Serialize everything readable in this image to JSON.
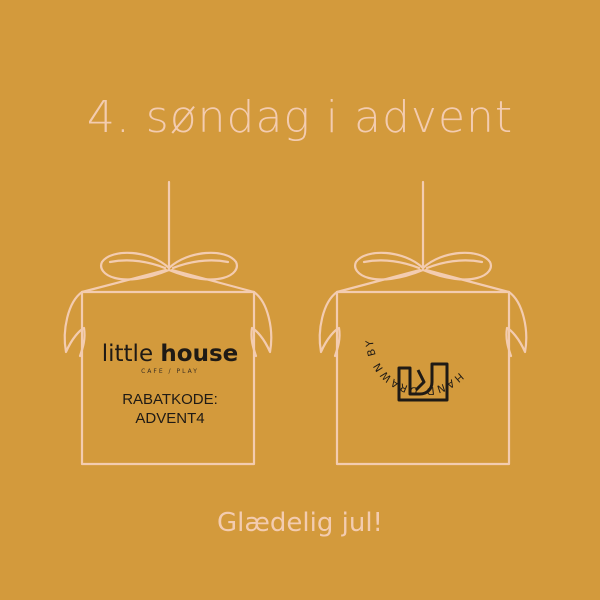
{
  "title": "4. søndag i advent",
  "gift_left": {
    "brand_light": "little ",
    "brand_bold": "house",
    "brand_tagline": "CAFE / PLAY",
    "code_label": "RABATKODE:",
    "code_value": "ADVENT4"
  },
  "gift_right": {
    "badge_text": "HAND DRAWN BY · ORIGINAL LINES ·"
  },
  "footer": "Glædelig jul!",
  "colors": {
    "background": "#d39a3c",
    "ribbon": "#f3ccb0",
    "ink": "#1f1a15"
  }
}
